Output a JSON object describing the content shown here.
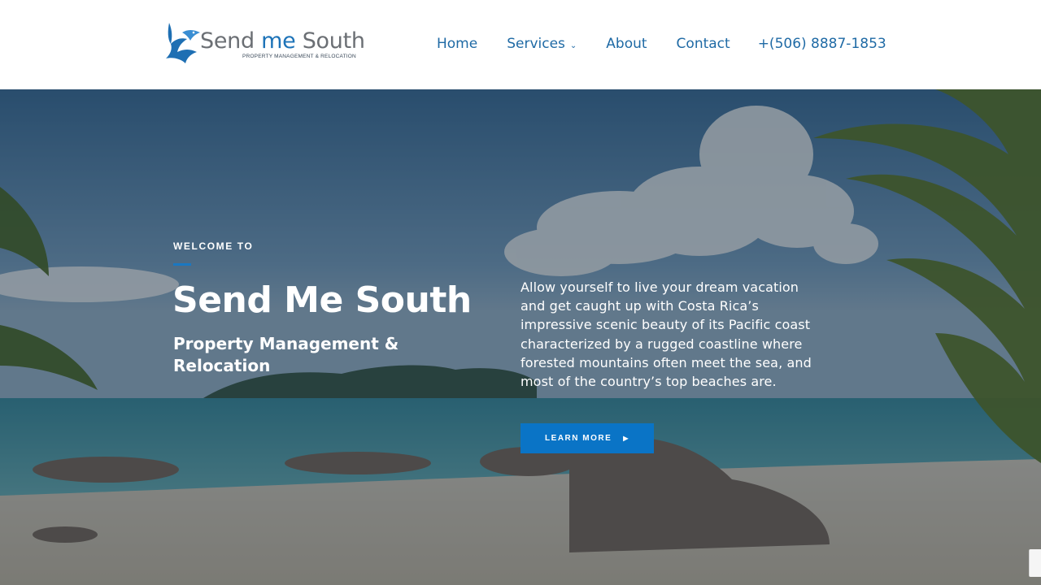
{
  "header": {
    "logo": {
      "title_part1": "Send ",
      "title_part2": "me",
      "title_part3": " South",
      "subtitle": "PROPERTY MANAGEMENT & RELOCATION",
      "icon": "swallow-bird-icon",
      "brand_color": "#1d73b8"
    },
    "nav": {
      "home": "Home",
      "services": "Services",
      "about": "About",
      "contact": "Contact",
      "phone": "+(506) 8887-1853"
    }
  },
  "hero": {
    "eyebrow": "WELCOME TO",
    "title": "Send Me South",
    "subtitle": "Property Management & Relocation",
    "description": "Allow yourself to live your dream vacation and get caught up with Costa Rica’s impressive scenic beauty of its Pacific coast characterized by a rugged coastline where forested mountains often meet the sea, and most of the country’s top beaches are.",
    "cta_label": "LEARN MORE",
    "cta_icon": "play-arrow-icon",
    "accent_color": "#0a74c6",
    "background": "tropical-beach-scene"
  }
}
